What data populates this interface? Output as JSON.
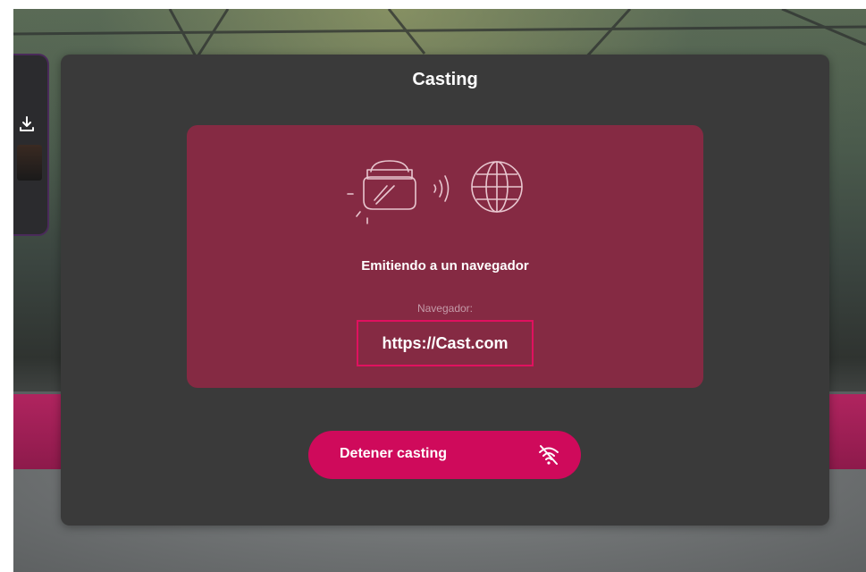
{
  "dialog": {
    "title": "Casting"
  },
  "cast_card": {
    "status": "Emitiendo a un navegador",
    "url_label": "Navegador:",
    "url": "https://Cast.com",
    "background_color": "#852a43"
  },
  "actions": {
    "stop_label": "Detener casting",
    "stop_icon": "wifi-off-icon",
    "button_color": "#cf0a5b"
  },
  "background_panel": {
    "icon": "download-icon"
  }
}
